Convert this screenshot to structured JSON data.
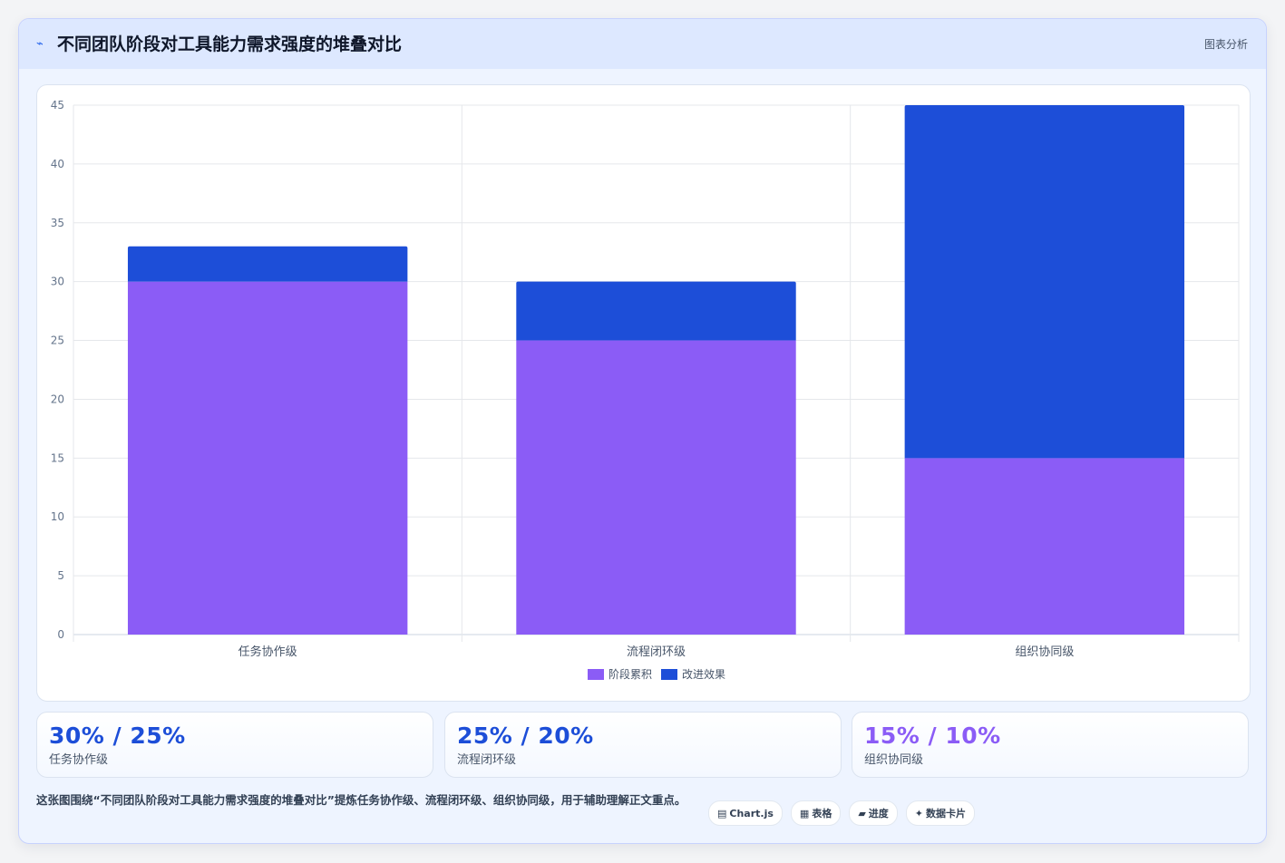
{
  "header": {
    "icon": "chart-line-icon",
    "title": "不同团队阶段对工具能力需求强度的堆叠对比",
    "tag": "图表分析"
  },
  "chart_data": {
    "type": "bar",
    "stacked": true,
    "categories": [
      "任务协作级",
      "流程闭环级",
      "组织协同级"
    ],
    "series": [
      {
        "name": "阶段累积",
        "values": [
          30,
          25,
          15
        ],
        "color": "#8b5cf6"
      },
      {
        "name": "改进效果",
        "values": [
          3,
          5,
          30
        ],
        "color": "#1d4ed8"
      }
    ],
    "ylim": [
      0,
      45
    ],
    "yticks": [
      0,
      5,
      10,
      15,
      20,
      25,
      30,
      35,
      40,
      45
    ],
    "grid": true,
    "legend": "bottom"
  },
  "stats": [
    {
      "value": "30% / 25%",
      "label": "任务协作级",
      "color": "#1d4ed8"
    },
    {
      "value": "25% / 20%",
      "label": "流程闭环级",
      "color": "#1d4ed8"
    },
    {
      "value": "15% / 10%",
      "label": "组织协同级",
      "color": "#8b5cf6"
    }
  ],
  "footer": {
    "note": "这张图围绕“不同团队阶段对工具能力需求强度的堆叠对比”提炼任务协作级、流程闭环级、组织协同级，用于辅助理解正文重点。",
    "pills": [
      {
        "icon": "chart-icon",
        "glyph": "▤",
        "label": "Chart.js"
      },
      {
        "icon": "table-icon",
        "glyph": "▦",
        "label": "表格"
      },
      {
        "icon": "progress-icon",
        "glyph": "▰",
        "label": "进度"
      },
      {
        "icon": "sparkle-icon",
        "glyph": "✦",
        "label": "数据卡片"
      }
    ]
  }
}
